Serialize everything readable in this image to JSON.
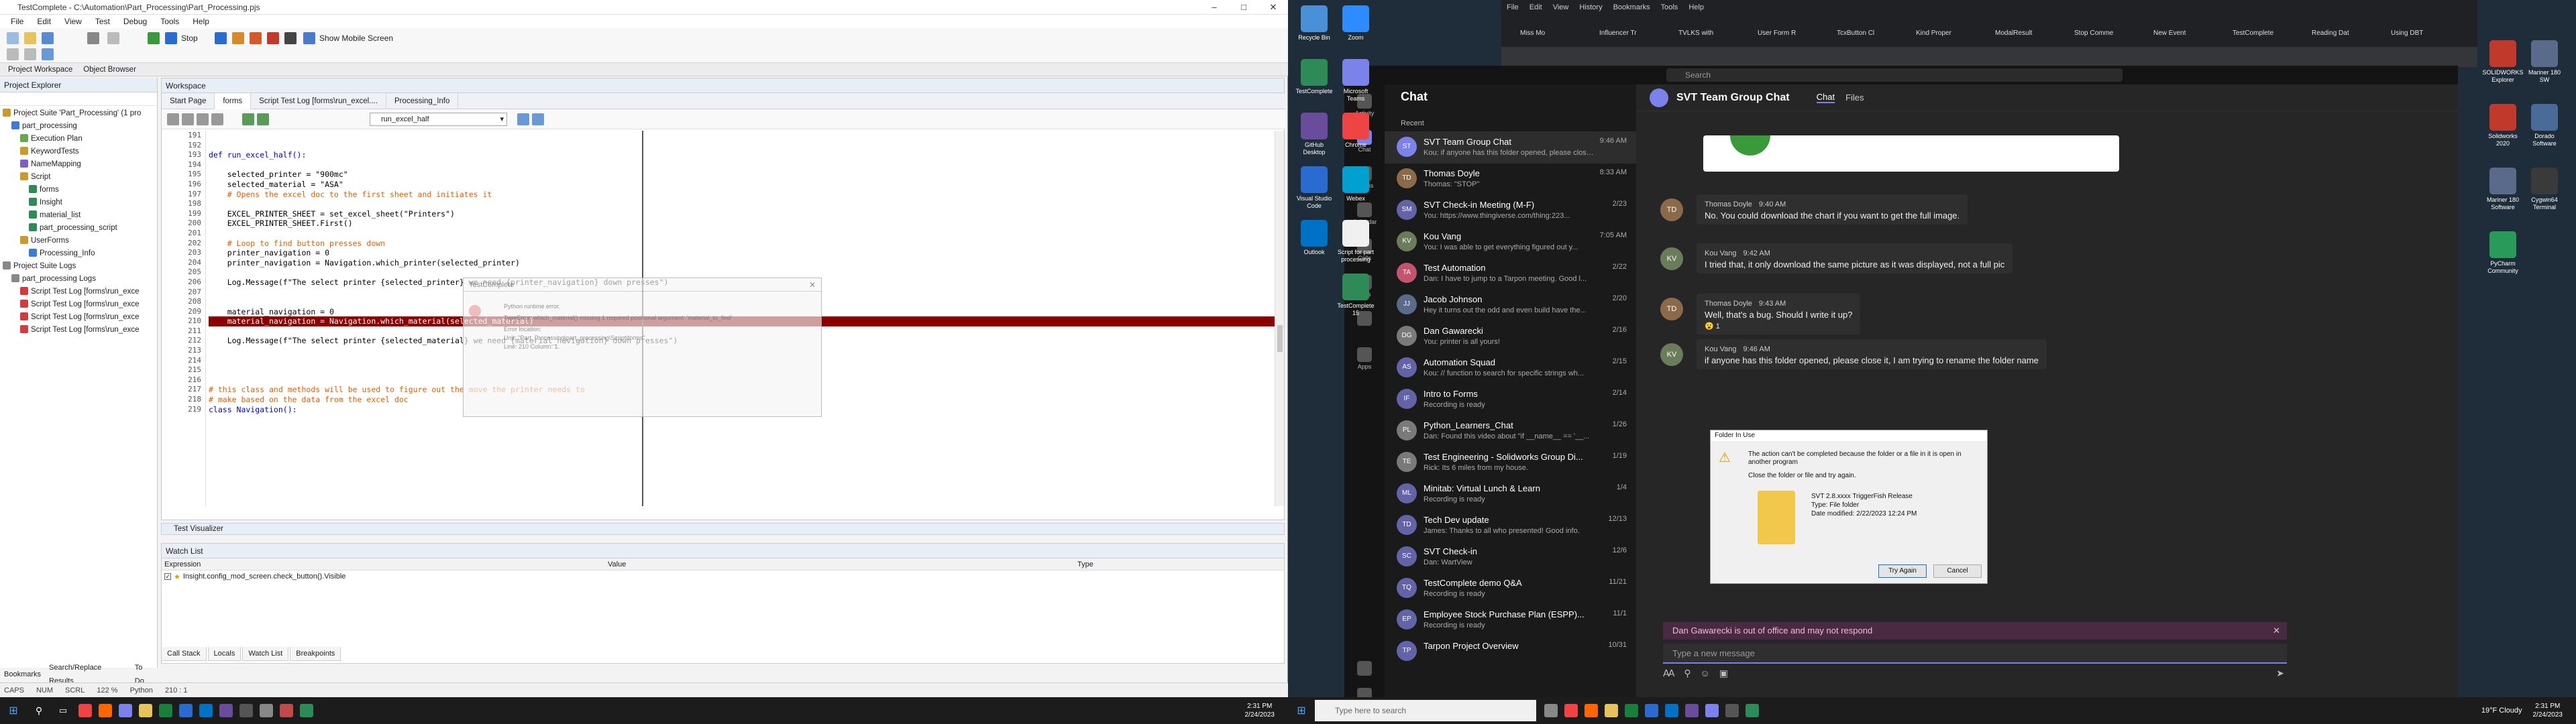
{
  "tc": {
    "title": "TestComplete - C:\\Automation\\Part_Processing\\Part_Processing.pjs",
    "menu": [
      "File",
      "Edit",
      "View",
      "Test",
      "Debug",
      "Tools",
      "Help"
    ],
    "toolbar": {
      "stop": "Stop",
      "mobile": "Show Mobile Screen"
    },
    "ribbon_tabs": [
      "Project Workspace",
      "Object Browser"
    ],
    "project_explorer": "Project Explorer",
    "workspace": "Workspace",
    "tree": [
      {
        "label": "Project Suite 'Part_Processing' (1 pro",
        "lvl": 0,
        "color": "#c99a2e"
      },
      {
        "label": "part_processing",
        "lvl": 1,
        "color": "#3a7bd5"
      },
      {
        "label": "Execution Plan",
        "lvl": 2,
        "color": "#6aa84f"
      },
      {
        "label": "KeywordTests",
        "lvl": 2,
        "color": "#c99a2e"
      },
      {
        "label": "NameMapping",
        "lvl": 2,
        "color": "#7b61c4"
      },
      {
        "label": "Script",
        "lvl": 2,
        "color": "#c99a2e"
      },
      {
        "label": "forms",
        "lvl": 3,
        "color": "#2e8b57"
      },
      {
        "label": "Insight",
        "lvl": 3,
        "color": "#2e8b57"
      },
      {
        "label": "material_list",
        "lvl": 3,
        "color": "#2e8b57"
      },
      {
        "label": "part_processing_script",
        "lvl": 3,
        "color": "#2e8b57"
      },
      {
        "label": "UserForms",
        "lvl": 2,
        "color": "#c99a2e"
      },
      {
        "label": "Processing_Info",
        "lvl": 3,
        "color": "#3a7bd5"
      },
      {
        "label": "Project Suite Logs",
        "lvl": 0,
        "color": "#888"
      },
      {
        "label": "part_processing Logs",
        "lvl": 1,
        "color": "#888"
      },
      {
        "label": "Script Test Log [forms\\run_exce",
        "lvl": 2,
        "color": "#d23b3b"
      },
      {
        "label": "Script Test Log [forms\\run_exce",
        "lvl": 2,
        "color": "#d23b3b"
      },
      {
        "label": "Script Test Log [forms\\run_exce",
        "lvl": 2,
        "color": "#d23b3b"
      },
      {
        "label": "Script Test Log [forms\\run_exce",
        "lvl": 2,
        "color": "#d23b3b"
      }
    ],
    "doc_tabs": [
      "Start Page",
      "forms",
      "Script Test Log [forms\\run_excel....",
      "Processing_Info"
    ],
    "func_dropdown": "run_excel_half",
    "code": [
      {
        "n": "191",
        "t": "",
        "c": ""
      },
      {
        "n": "192",
        "t": "",
        "c": ""
      },
      {
        "n": "193",
        "t": "def run_excel_half():",
        "c": "kw"
      },
      {
        "n": "194",
        "t": "",
        "c": ""
      },
      {
        "n": "195",
        "t": "    selected_printer = \"900mc\"",
        "c": ""
      },
      {
        "n": "196",
        "t": "    selected_material = \"ASA\"",
        "c": ""
      },
      {
        "n": "197",
        "t": "    # Opens the excel doc to the first sheet and initiates it",
        "c": "cm"
      },
      {
        "n": "198",
        "t": "",
        "c": ""
      },
      {
        "n": "199",
        "t": "    EXCEL_PRINTER_SHEET = set_excel_sheet(\"Printers\")",
        "c": ""
      },
      {
        "n": "200",
        "t": "    EXCEL_PRINTER_SHEET.First()",
        "c": ""
      },
      {
        "n": "201",
        "t": "",
        "c": ""
      },
      {
        "n": "202",
        "t": "    # Loop to find button presses down",
        "c": "cm"
      },
      {
        "n": "203",
        "t": "    printer_navigation = 0",
        "c": ""
      },
      {
        "n": "204",
        "t": "    printer_navigation = Navigation.which_printer(selected_printer)",
        "c": ""
      },
      {
        "n": "205",
        "t": "",
        "c": ""
      },
      {
        "n": "206",
        "t": "    Log.Message(f\"The select printer {selected_printer} we need {printer_navigation} down presses\")",
        "c": ""
      },
      {
        "n": "207",
        "t": "",
        "c": ""
      },
      {
        "n": "208",
        "t": "",
        "c": ""
      },
      {
        "n": "209",
        "t": "    material_navigation = 0",
        "c": ""
      },
      {
        "n": "210",
        "t": "    material_navigation = Navigation.which_material(selected_material)",
        "c": "hl"
      },
      {
        "n": "211",
        "t": "",
        "c": ""
      },
      {
        "n": "212",
        "t": "    Log.Message(f\"The select printer {selected_material} we need {material_navigation} down presses\")",
        "c": ""
      },
      {
        "n": "213",
        "t": "",
        "c": ""
      },
      {
        "n": "214",
        "t": "",
        "c": ""
      },
      {
        "n": "215",
        "t": "",
        "c": ""
      },
      {
        "n": "216",
        "t": "",
        "c": ""
      },
      {
        "n": "217",
        "t": "# this class and methods will be used to figure out the move the printer needs to",
        "c": "cm"
      },
      {
        "n": "218",
        "t": "# make based on the data from the excel doc",
        "c": "cm"
      },
      {
        "n": "219",
        "t": "class Navigation():",
        "c": "kw"
      }
    ],
    "popup": {
      "title": "TestComplete",
      "l1": "Python runtime error.",
      "l2": "TypeError: which_material() missing 1 required positional argument: 'material_to_find'",
      "l3": "Error location:",
      "l4": "Unit: \"Part_Processing\\part_processing\\Script\\forms\"",
      "l5": "Line: 210 Column: 1."
    },
    "test_visualizer": "Test Visualizer",
    "watch_list": "Watch List",
    "watch_cols": [
      "Expression",
      "Value",
      "Type"
    ],
    "watch_row": "Insight.config_mod_screen.check_button().Visible",
    "bottom_tabs": [
      "Call Stack",
      "Locals",
      "Watch List",
      "Breakpoints"
    ],
    "left_tabs": [
      "Bookmarks",
      "Search/Replace Results",
      "To Do"
    ],
    "status": [
      "CAPS",
      "NUM",
      "SCRL",
      "122 %",
      "Python",
      "210 : 1"
    ]
  },
  "taskbar_left": {
    "time": "2:31 PM",
    "date": "2/24/2023",
    "search": "Type here to search"
  },
  "taskbar_right": {
    "time": "2:31 PM",
    "date": "2/24/2023",
    "weather": "19°F Cloudy"
  },
  "desktop_icons": [
    "Recycle Bin",
    "TestComplete",
    "GitHub Desktop",
    "Visual Studio Code",
    "Outlook",
    "Zoom",
    "Microsoft Teams",
    "Chrome",
    "Webex",
    "Script for part processing",
    "TestComplete 15"
  ],
  "desktop_icons_right": [
    "SOLIDWORKS Explorer",
    "Mariner 180 SW",
    "Solidworks 2020",
    "Dorado Software",
    "Mariner 180 Software",
    "Cygwin64 Terminal",
    "PyCharm Community"
  ],
  "browser_tabs": [
    "Miss Mo",
    "Influencer Tr",
    "TVLKS with",
    "User Form R",
    "TcxButton Cl",
    "Kind Proper",
    "ModalResult",
    "Stop Comme",
    "New Event",
    "TestComplete",
    "Reading Dat",
    "Using DBT"
  ],
  "browser_menu": [
    "File",
    "Edit",
    "View",
    "History",
    "Bookmarks",
    "Tools",
    "Help"
  ],
  "teams": {
    "search": "Search",
    "rail": [
      "Activity",
      "Chat",
      "Teams",
      "Calendar",
      "Calls",
      "Files",
      "",
      "Apps",
      "",
      "Help"
    ],
    "chat_header": "Chat",
    "recent": "Recent",
    "chats": [
      {
        "name": "SVT Team Group Chat",
        "prev": "Kou: if anyone has this folder opened, please close it...",
        "time": "9:46 AM",
        "ini": "ST",
        "col": "#7b83eb",
        "active": true
      },
      {
        "name": "Thomas Doyle",
        "prev": "Thomas: \"STOP\"",
        "time": "8:33 AM",
        "ini": "TD",
        "col": "#8a6a4a"
      },
      {
        "name": "SVT Check-in Meeting (M-F)",
        "prev": "You: https://www.thingiverse.com/thing:223...",
        "time": "2/23",
        "ini": "SM",
        "col": "#6264a7"
      },
      {
        "name": "Kou Vang",
        "prev": "You: I was able to get everything figured out y...",
        "time": "7:05 AM",
        "ini": "KV",
        "col": "#6a7d5a"
      },
      {
        "name": "Test Automation",
        "prev": "Dan: I have to jump to a Tarpon meeting. Good l...",
        "time": "2/22",
        "ini": "TA",
        "col": "#c2556b"
      },
      {
        "name": "Jacob Johnson",
        "prev": "Hey it turns out the odd and even build have the...",
        "time": "2/20",
        "ini": "JJ",
        "col": "#5a6a8a"
      },
      {
        "name": "Dan Gawarecki",
        "prev": "You: printer is all yours!",
        "time": "2/16",
        "ini": "DG",
        "col": "#7a7a7a"
      },
      {
        "name": "Automation Squad",
        "prev": "Kou: // function to search for specific strings wh...",
        "time": "2/15",
        "ini": "AS",
        "col": "#6264a7"
      },
      {
        "name": "Intro to Forms",
        "prev": "Recording is ready",
        "time": "2/14",
        "ini": "IF",
        "col": "#6264a7"
      },
      {
        "name": "Python_Learners_Chat",
        "prev": "Dan: Found this video about \"if __name__ == '__...",
        "time": "1/26",
        "ini": "PL",
        "col": "#7a7a7a"
      },
      {
        "name": "Test Engineering - Solidworks Group Di...",
        "prev": "Rick: Its 6 miles from my house.",
        "time": "1/19",
        "ini": "TE",
        "col": "#7a7a7a"
      },
      {
        "name": "Minitab: Virtual Lunch & Learn",
        "prev": "Recording is ready",
        "time": "1/4",
        "ini": "ML",
        "col": "#6264a7"
      },
      {
        "name": "Tech Dev update",
        "prev": "James: Thanks to all who presented! Good info.",
        "time": "12/13",
        "ini": "TD",
        "col": "#6264a7"
      },
      {
        "name": "SVT Check-in",
        "prev": "Dan: WartView",
        "time": "12/6",
        "ini": "SC",
        "col": "#6264a7"
      },
      {
        "name": "TestComplete demo Q&A",
        "prev": "Recording is ready",
        "time": "11/21",
        "ini": "TQ",
        "col": "#6264a7"
      },
      {
        "name": "Employee Stock Purchase Plan (ESPP)...",
        "prev": "Recording is ready",
        "time": "11/1",
        "ini": "EP",
        "col": "#6264a7"
      },
      {
        "name": "Tarpon Project Overview",
        "prev": "",
        "time": "10/31",
        "ini": "TP",
        "col": "#6264a7"
      }
    ],
    "group_title": "SVT Team Group Chat",
    "group_tabs": [
      "Chat",
      "Files"
    ],
    "messages": [
      {
        "who": "Thomas Doyle",
        "time": "9:40 AM",
        "text": "No. You could download the chart if you want to get the full image.",
        "ini": "TD",
        "col": "#8a6a4a"
      },
      {
        "who": "Kou Vang",
        "time": "9:42 AM",
        "text": "I tried that, it only download the same picture as it was displayed, not a full pic",
        "ini": "KV",
        "col": "#6a7d5a"
      },
      {
        "who": "Thomas Doyle",
        "time": "9:43 AM",
        "text": "Well, that's a bug.  Should I write it up?",
        "ini": "TD",
        "col": "#8a6a4a"
      },
      {
        "who": "Kou Vang",
        "time": "9:46 AM",
        "text": "if anyone has this folder opened, please close it, I am trying to rename the folder name",
        "ini": "KV",
        "col": "#6a7d5a"
      }
    ],
    "dialog": {
      "title": "Folder In Use",
      "line1": "The action can't be completed because the folder or a file in it is open in another program",
      "line2": "Close the folder or file and try again.",
      "file": "SVT 2.8.xxxx TriggerFish Release",
      "type": "Type: File folder",
      "date": "Date modified: 2/22/2023 12:24 PM",
      "retry": "Try Again",
      "cancel": "Cancel"
    },
    "reaction": "1",
    "ooo": "Dan Gawarecki is out of office and may not respond",
    "compose": "Type a new message"
  }
}
